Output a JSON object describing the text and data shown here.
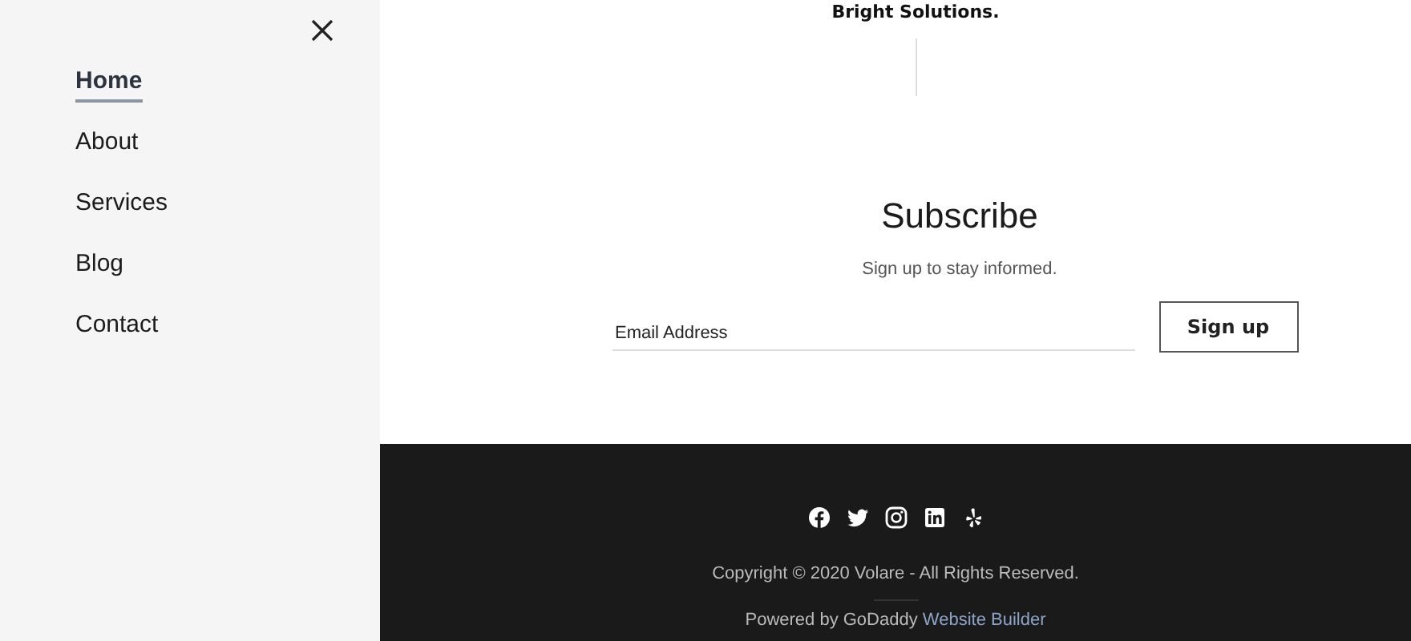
{
  "menu": {
    "items": [
      {
        "label": "Home",
        "selected": true
      },
      {
        "label": "About",
        "selected": false
      },
      {
        "label": "Services",
        "selected": false
      },
      {
        "label": "Blog",
        "selected": false
      },
      {
        "label": "Contact",
        "selected": false
      }
    ]
  },
  "tagline": "Bright Solutions.",
  "subscribe": {
    "title": "Subscribe",
    "subtitle": "Sign up to stay informed.",
    "placeholder": "Email Address",
    "button": "Sign up"
  },
  "footer": {
    "social": [
      {
        "kind": "facebook"
      },
      {
        "kind": "twitter"
      },
      {
        "kind": "instagram"
      },
      {
        "kind": "linkedin"
      },
      {
        "kind": "yelp"
      }
    ],
    "copyright": "Copyright © 2020 Volare - All Rights Reserved.",
    "powered": "Powered by GoDaddy",
    "powered_link": "Website Builder"
  }
}
